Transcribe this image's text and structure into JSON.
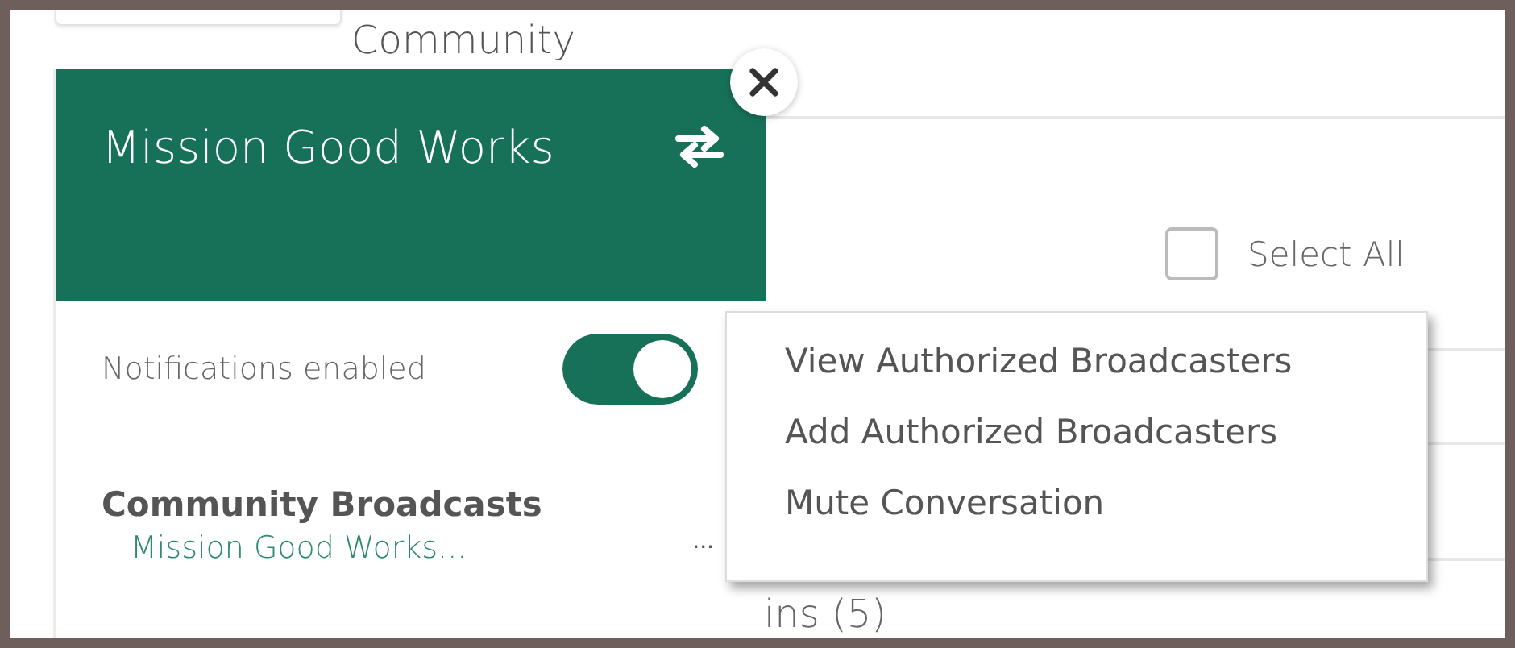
{
  "background": {
    "heading": "Community",
    "select_all": {
      "label": "Select All",
      "checked": false
    },
    "partial_text": "ins (5)"
  },
  "panel": {
    "title": "Mission Good Works",
    "notifications": {
      "label": "Notifications enabled",
      "on": true
    },
    "section_title": "Community Broadcasts",
    "conversation": {
      "name": "Mission Good Works...",
      "more": "..."
    }
  },
  "menu": {
    "items": [
      "View Authorized Broadcasters",
      "Add Authorized Broadcasters",
      "Mute Conversation"
    ]
  }
}
